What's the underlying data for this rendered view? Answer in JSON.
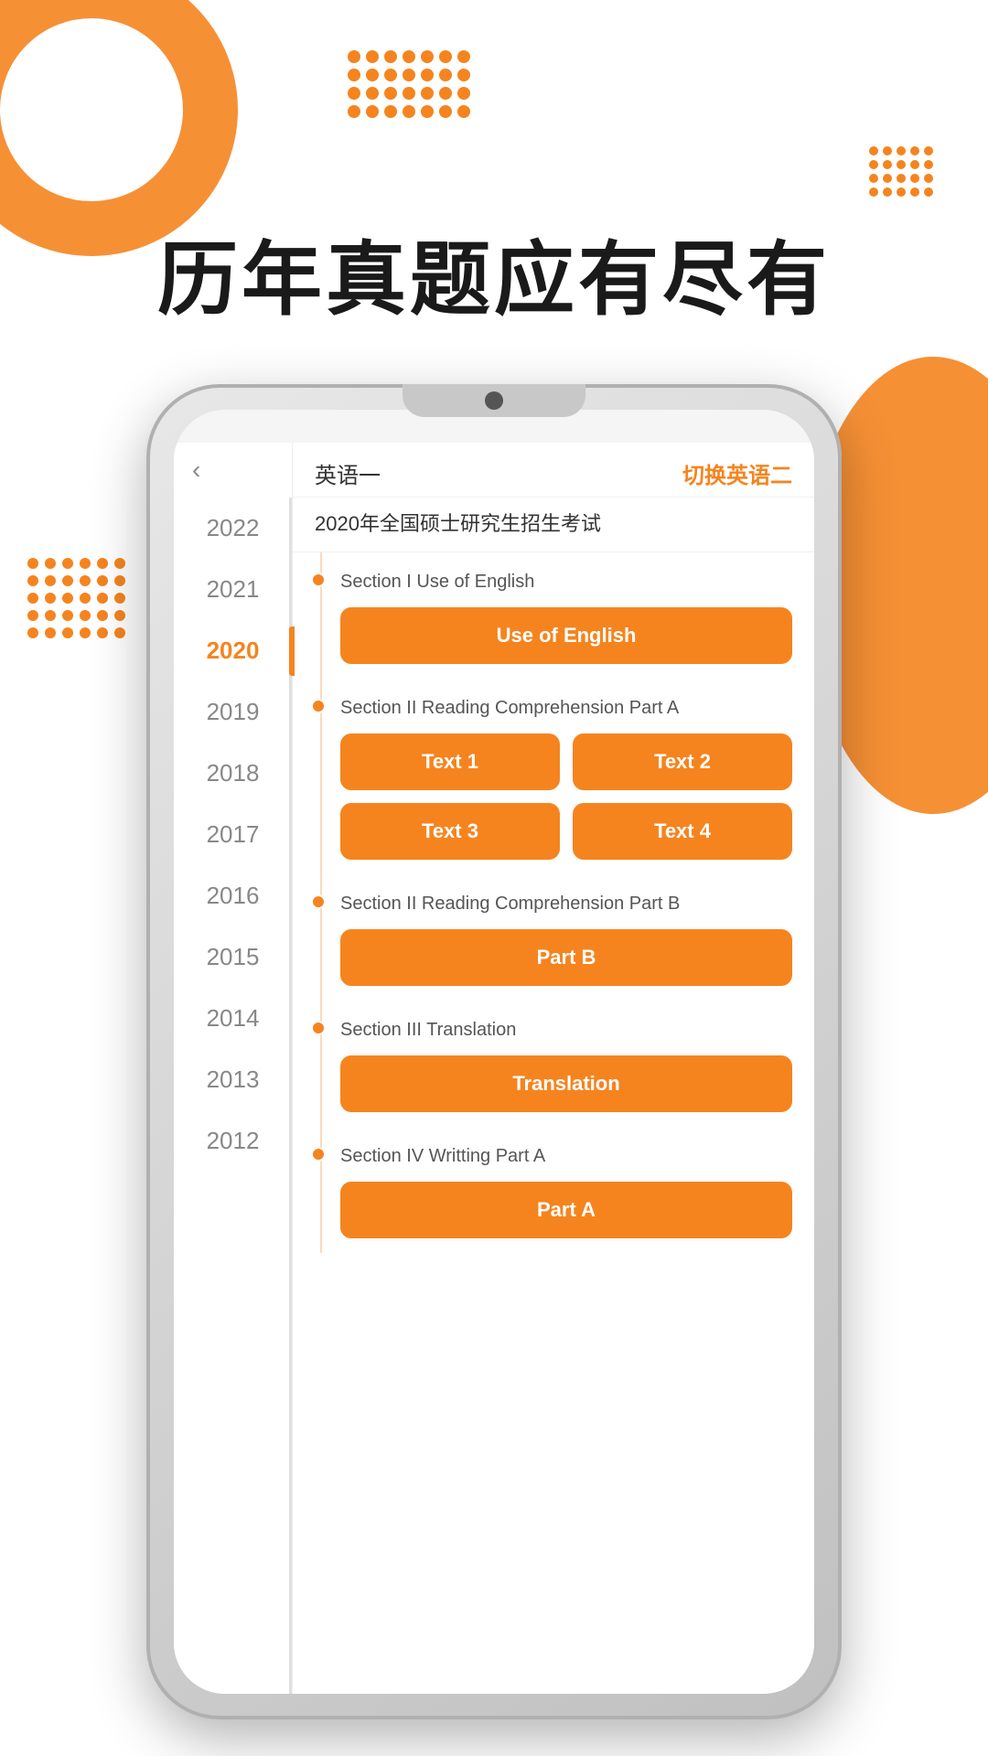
{
  "page": {
    "heading": "历年真题应有尽有",
    "bg": {
      "dots_color": "#F5841F"
    }
  },
  "phone": {
    "header": {
      "lang_title": "英语一",
      "lang_switch": "切换英语二"
    },
    "exam_title": "2020年全国硕士研究生招生考试",
    "sections": [
      {
        "id": "section1",
        "label": "Section I Use of English",
        "dot": true,
        "buttons": [
          {
            "label": "Use of English"
          }
        ],
        "single": true
      },
      {
        "id": "section2",
        "label": "Section II Reading Comprehension Part A",
        "dot": true,
        "buttons": [
          {
            "label": "Text 1"
          },
          {
            "label": "Text 2"
          },
          {
            "label": "Text 3"
          },
          {
            "label": "Text 4"
          }
        ],
        "single": false
      },
      {
        "id": "section3",
        "label": "Section II Reading Comprehension Part B",
        "dot": true,
        "buttons": [
          {
            "label": "Part B"
          }
        ],
        "single": true
      },
      {
        "id": "section4",
        "label": "Section III Translation",
        "dot": true,
        "buttons": [
          {
            "label": "Translation"
          }
        ],
        "single": true
      },
      {
        "id": "section5",
        "label": "Section IV Writting Part A",
        "dot": true,
        "buttons": [
          {
            "label": "Part A"
          }
        ],
        "single": true
      }
    ],
    "years": [
      {
        "year": "2022",
        "active": false
      },
      {
        "year": "2021",
        "active": false
      },
      {
        "year": "2020",
        "active": true
      },
      {
        "year": "2019",
        "active": false
      },
      {
        "year": "2018",
        "active": false
      },
      {
        "year": "2017",
        "active": false
      },
      {
        "year": "2016",
        "active": false
      },
      {
        "year": "2015",
        "active": false
      },
      {
        "year": "2014",
        "active": false
      },
      {
        "year": "2013",
        "active": false
      },
      {
        "year": "2012",
        "active": false
      }
    ]
  }
}
